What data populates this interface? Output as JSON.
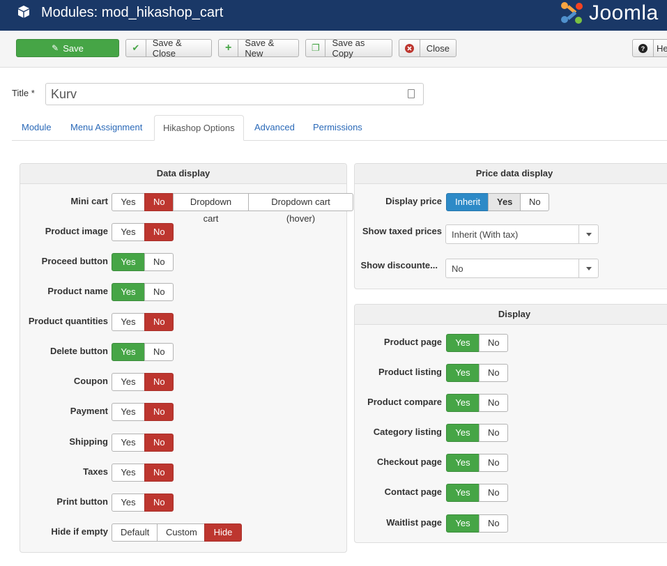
{
  "header": {
    "title": "Modules: mod_hikashop_cart",
    "logo_text": "Joomla"
  },
  "toolbar": {
    "save": "Save",
    "save_close": "Save & Close",
    "save_new": "Save & New",
    "save_copy": "Save as Copy",
    "close": "Close",
    "help": "He"
  },
  "form": {
    "title_label": "Title *",
    "title_value": "Kurv"
  },
  "tabs": [
    "Module",
    "Menu Assignment",
    "Hikashop Options",
    "Advanced",
    "Permissions"
  ],
  "data_display": {
    "heading": "Data display",
    "mini_cart": {
      "label": "Mini cart",
      "options": [
        "Yes",
        "No",
        "Dropdown cart",
        "Dropdown cart (hover)"
      ]
    },
    "rows": [
      {
        "label": "Product image",
        "selected": "No"
      },
      {
        "label": "Proceed button",
        "selected": "Yes"
      },
      {
        "label": "Product name",
        "selected": "Yes"
      },
      {
        "label": "Product quantities",
        "selected": "No"
      },
      {
        "label": "Delete button",
        "selected": "Yes"
      },
      {
        "label": "Coupon",
        "selected": "No"
      },
      {
        "label": "Payment",
        "selected": "No"
      },
      {
        "label": "Shipping",
        "selected": "No"
      },
      {
        "label": "Taxes",
        "selected": "No"
      },
      {
        "label": "Print button",
        "selected": "No"
      }
    ],
    "hide_if_empty": {
      "label": "Hide if empty",
      "options": [
        "Default",
        "Custom",
        "Hide"
      ]
    },
    "yes": "Yes",
    "no": "No"
  },
  "price_display": {
    "heading": "Price data display",
    "display_price": {
      "label": "Display price",
      "options": [
        "Inherit",
        "Yes",
        "No"
      ]
    },
    "taxed": {
      "label": "Show taxed prices",
      "value": "Inherit (With tax)"
    },
    "discounted": {
      "label": "Show discounte...",
      "value": "No"
    }
  },
  "display": {
    "heading": "Display",
    "rows": [
      "Product page",
      "Product listing",
      "Product compare",
      "Category listing",
      "Checkout page",
      "Contact page",
      "Waitlist page"
    ]
  },
  "colors": {
    "header_bg": "#1a3867",
    "green": "#46a546",
    "red": "#bd362f",
    "blue": "#2d8ac7"
  }
}
